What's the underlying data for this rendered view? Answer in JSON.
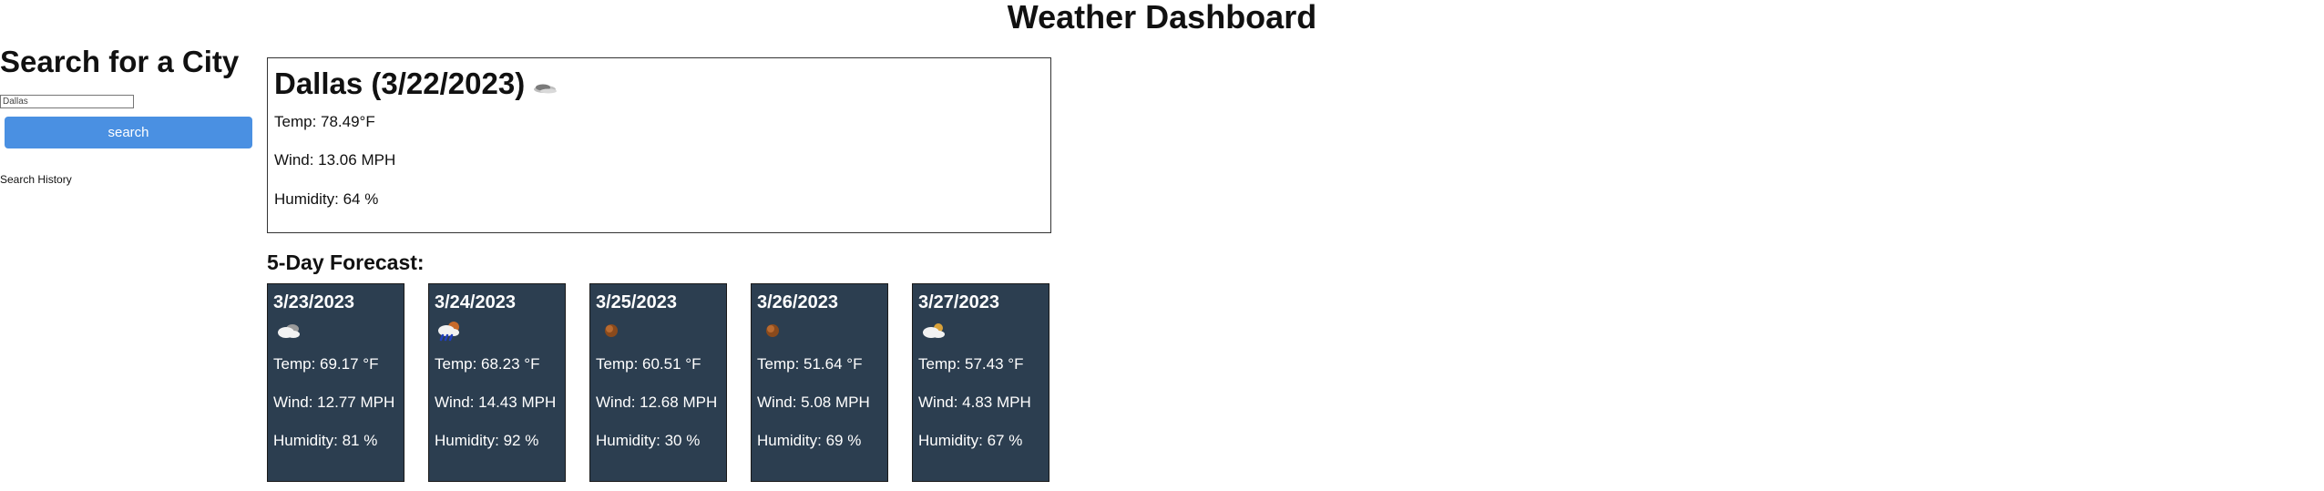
{
  "header": {
    "title": "Weather Dashboard"
  },
  "sidebar": {
    "heading": "Search for a City",
    "search_value": "Dallas",
    "search_button": "search",
    "history_label": "Search History"
  },
  "current": {
    "title": "Dallas (3/22/2023)",
    "icon": "few-clouds-night-icon",
    "temp": "Temp: 78.49°F",
    "wind": "Wind: 13.06 MPH",
    "humidity": "Humidity: 64 %"
  },
  "forecast": {
    "heading": "5-Day Forecast:",
    "days": [
      {
        "date": "3/23/2023",
        "icon": "broken-clouds-icon",
        "temp": "Temp: 69.17 °F",
        "wind": "Wind: 12.77 MPH",
        "humidity": "Humidity: 81 %"
      },
      {
        "date": "3/24/2023",
        "icon": "rain-icon",
        "temp": "Temp: 68.23 °F",
        "wind": "Wind: 14.43 MPH",
        "humidity": "Humidity: 92 %"
      },
      {
        "date": "3/25/2023",
        "icon": "clear-night-icon",
        "temp": "Temp: 60.51 °F",
        "wind": "Wind: 12.68 MPH",
        "humidity": "Humidity: 30 %"
      },
      {
        "date": "3/26/2023",
        "icon": "clear-night-icon",
        "temp": "Temp: 51.64 °F",
        "wind": "Wind: 5.08 MPH",
        "humidity": "Humidity: 69 %"
      },
      {
        "date": "3/27/2023",
        "icon": "few-clouds-icon",
        "temp": "Temp: 57.43 °F",
        "wind": "Wind: 4.83 MPH",
        "humidity": "Humidity: 67 %"
      }
    ]
  },
  "colors": {
    "card_bg": "#2c3e50",
    "button_bg": "#4a90e2"
  }
}
